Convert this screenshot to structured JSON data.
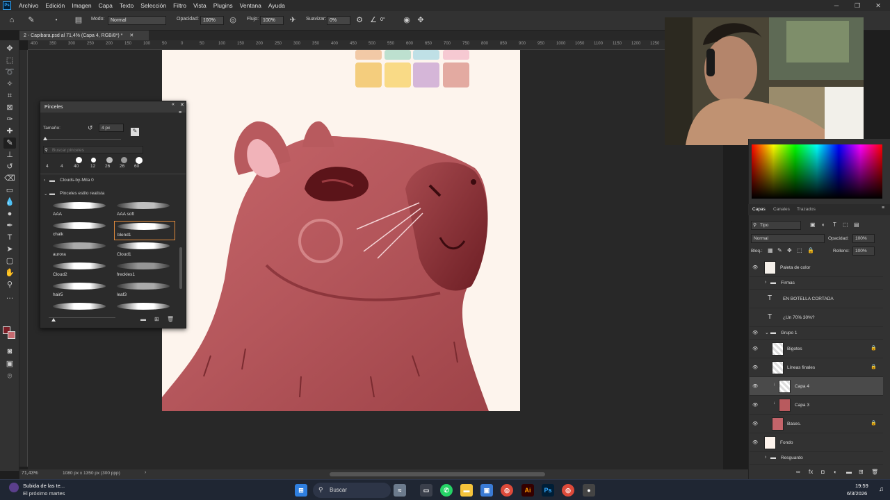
{
  "app": {
    "logo": "Ps"
  },
  "menu": [
    "Archivo",
    "Edición",
    "Imagen",
    "Capa",
    "Texto",
    "Selección",
    "Filtro",
    "Vista",
    "Plugins",
    "Ventana",
    "Ayuda"
  ],
  "options": {
    "mode_label": "Modo:",
    "mode_value": "Normal",
    "opacity_label": "Opacidad:",
    "opacity_value": "100%",
    "flow_label": "Flujo:",
    "flow_value": "100%",
    "smoothing_label": "Suavizar:",
    "smoothing_value": "0%",
    "angle_value": "0°"
  },
  "document": {
    "tab_title": "2 - Capibara.psd al 71,4% (Capa 4, RGB/8*) *"
  },
  "ruler_ticks": [
    "400",
    "350",
    "300",
    "250",
    "200",
    "150",
    "100",
    "50",
    "0",
    "50",
    "100",
    "150",
    "200",
    "250",
    "300",
    "350",
    "400",
    "450",
    "500",
    "550",
    "600",
    "650",
    "700",
    "750",
    "800",
    "850",
    "900",
    "950",
    "1000",
    "1050",
    "1100",
    "1150",
    "1200",
    "1250",
    "1300",
    "1350",
    "1400",
    "1450",
    "1500"
  ],
  "brushes_panel": {
    "title": "Pinceles",
    "size_label": "Tamaño:",
    "size_value": "4 px",
    "search_placeholder": "Buscar pinceles",
    "recent_sizes": [
      "4",
      "4",
      "40",
      "12",
      "26",
      "26",
      "60"
    ],
    "groups": [
      "Clouds-by-Mila 0",
      "Pinceles estilo realista"
    ],
    "presets": [
      "AAA",
      "AAA soft",
      "chalk",
      "blend1",
      "aurora",
      "Cloud1",
      "Cloud2",
      "freckles1",
      "hair5",
      "leaf3"
    ]
  },
  "layers_panel": {
    "tabs": [
      "Capas",
      "Canales",
      "Trazados"
    ],
    "filter": "Tipo",
    "blend_mode": "Normal",
    "opacity_label": "Opacidad:",
    "opacity_value": "100%",
    "lock_label": "Bloq.:",
    "fill_label": "Relleno:",
    "fill_value": "100%",
    "layers": [
      "Paleta de color",
      "Firmas",
      "EN BOTELLA CORTADA",
      "¿Un 70% 30%?",
      "Grupo 1",
      "Bigotes",
      "Líneas finales",
      "Capa 4",
      "Capa 3",
      "Bases.",
      "Fondo",
      "Resguardo"
    ]
  },
  "status": {
    "zoom": "71,43%",
    "doc_info": "1080 px x 1350 px (300 ppp)"
  },
  "taskbar": {
    "notification_title": "Subida de las te...",
    "notification_sub": "El próximo martes",
    "search": "Buscar",
    "time": "19:59",
    "date": "6/3/2026"
  },
  "colors": {
    "accent": "#31a8ff",
    "capybara": "#b85a5e",
    "canvas_bg": "#fdf4ed"
  }
}
